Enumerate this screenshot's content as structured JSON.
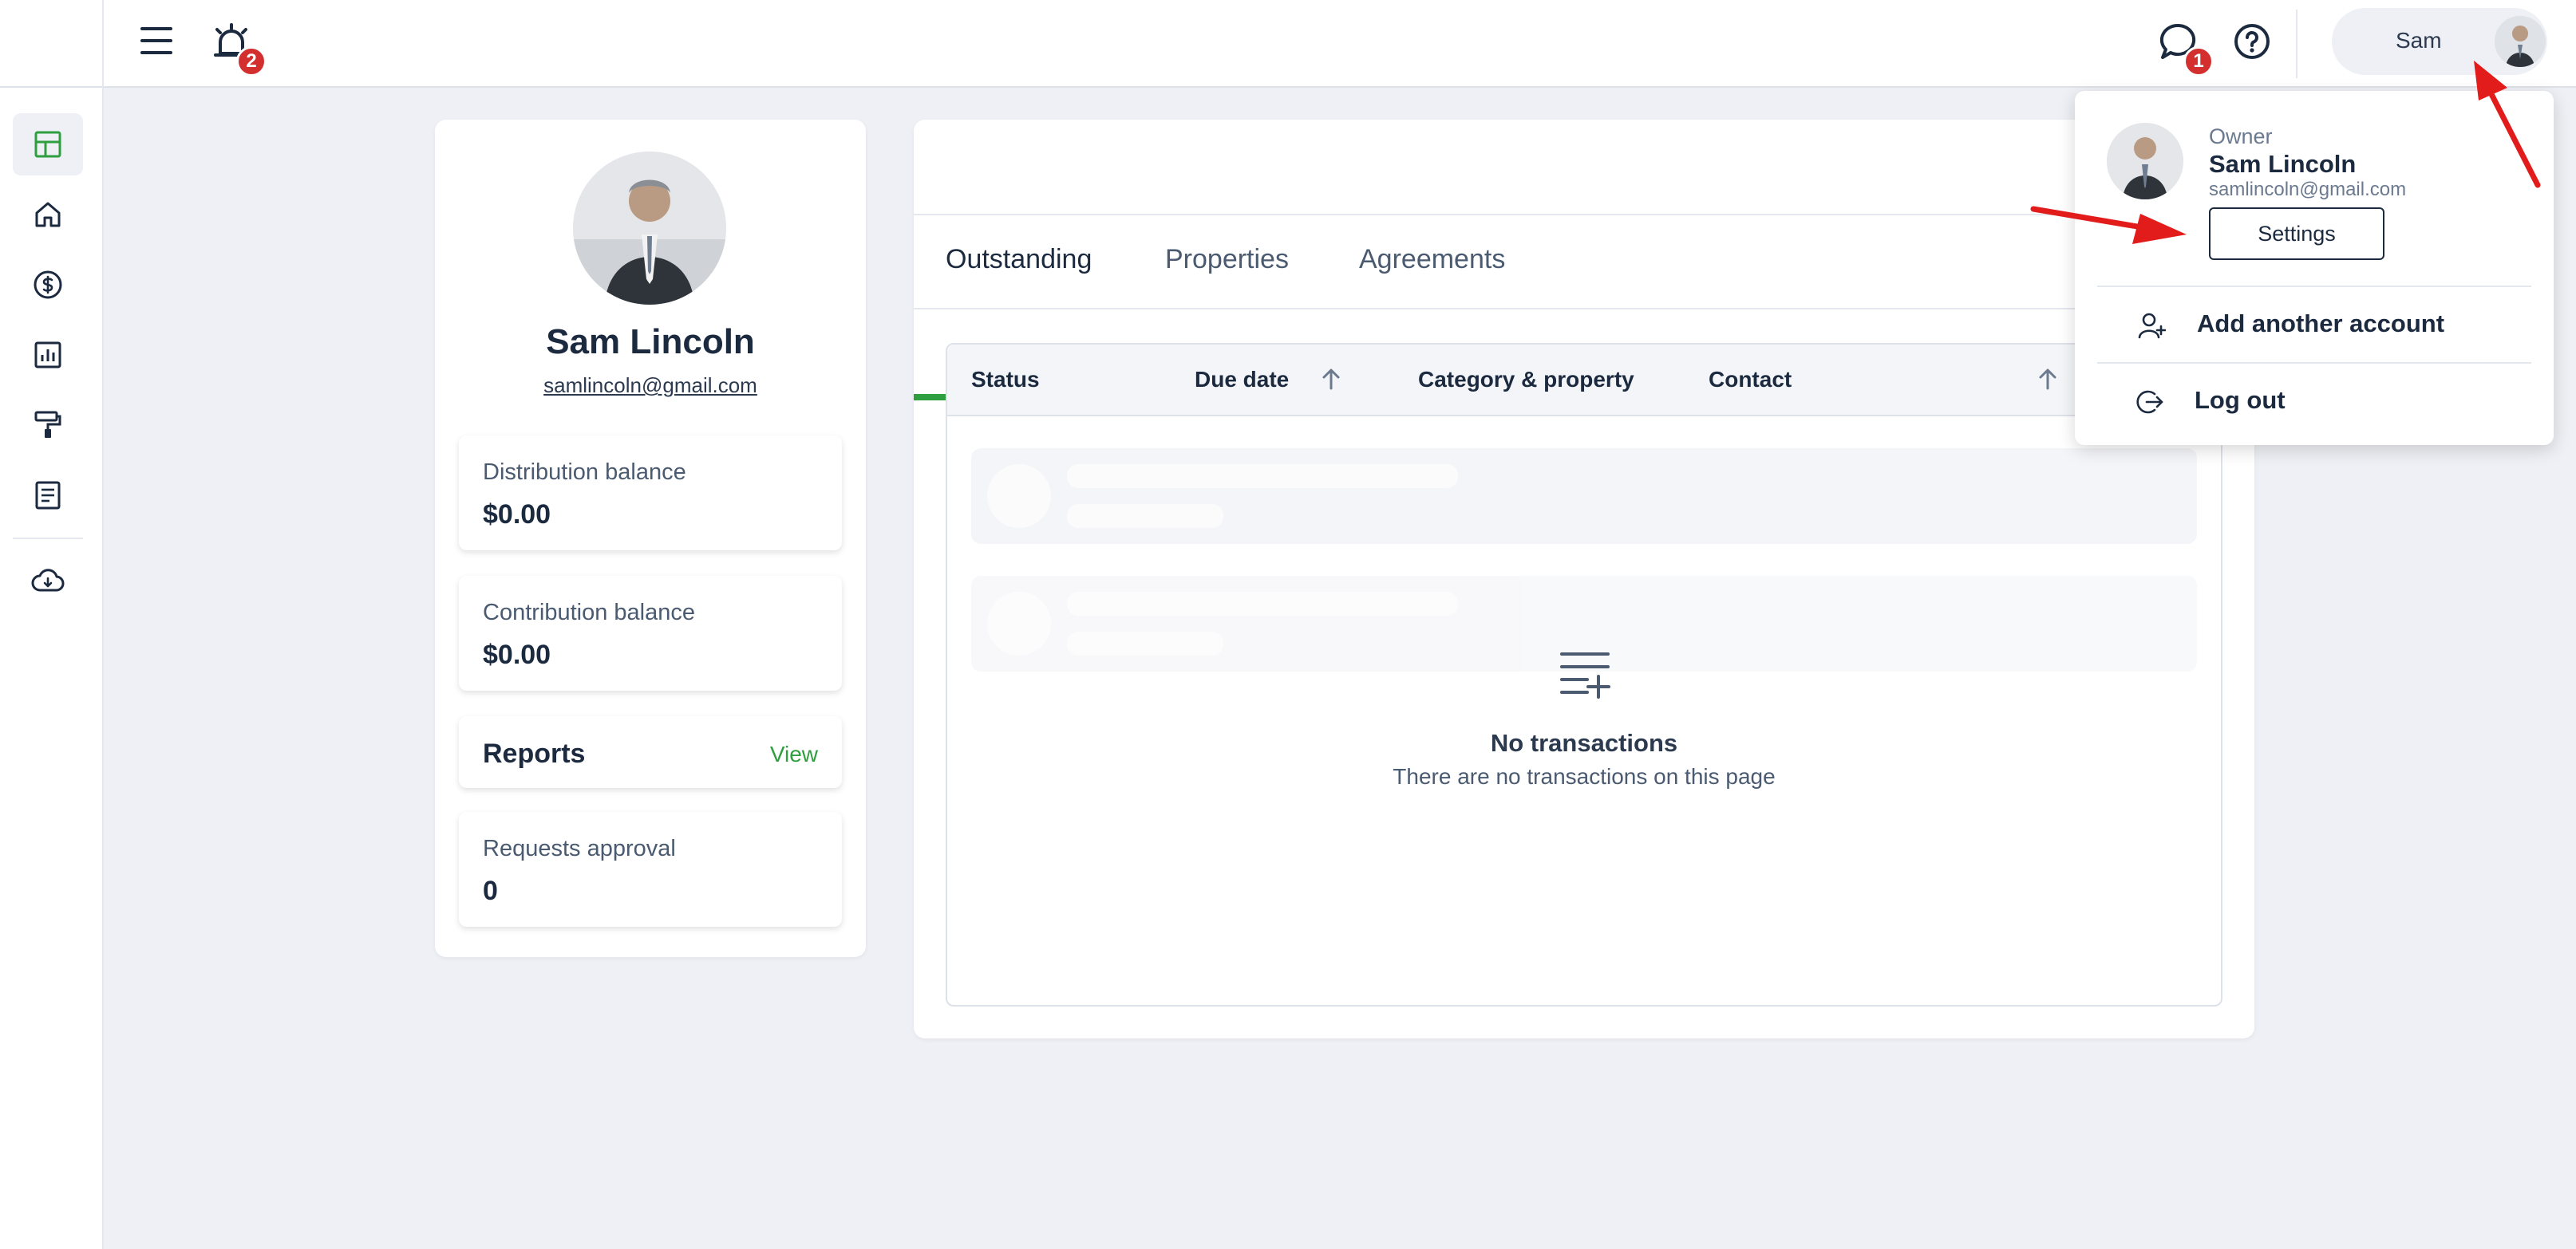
{
  "header": {
    "notifications_count": "2",
    "messages_count": "1",
    "user_short_name": "Sam"
  },
  "sidebar": {
    "items": [
      {
        "icon": "dashboard-icon",
        "active": true
      },
      {
        "icon": "home-icon"
      },
      {
        "icon": "dollar-icon"
      },
      {
        "icon": "chart-icon"
      },
      {
        "icon": "paint-roller-icon"
      },
      {
        "icon": "document-icon"
      },
      {
        "icon": "cloud-download-icon"
      }
    ]
  },
  "profile": {
    "name": "Sam Lincoln",
    "email": "samlincoln@gmail.com",
    "distribution_label": "Distribution balance",
    "distribution_value": "$0.00",
    "contribution_label": "Contribution balance",
    "contribution_value": "$0.00",
    "reports_label": "Reports",
    "reports_link": "View",
    "requests_label": "Requests approval",
    "requests_value": "0"
  },
  "main": {
    "tabs": [
      {
        "label": "Outstanding",
        "active": true
      },
      {
        "label": "Properties"
      },
      {
        "label": "Agreements"
      }
    ],
    "columns": [
      "Status",
      "Due date",
      "Category & property",
      "Contact"
    ],
    "empty_title": "No transactions",
    "empty_subtitle": "There are no transactions on this page"
  },
  "dropdown": {
    "role": "Owner",
    "name": "Sam Lincoln",
    "email": "samlincoln@gmail.com",
    "settings_label": "Settings",
    "add_account_label": "Add another account",
    "logout_label": "Log out"
  },
  "colors": {
    "accent": "#2e9e3e",
    "badge": "#d32f2f",
    "annotation_arrow": "#e21b1b"
  }
}
